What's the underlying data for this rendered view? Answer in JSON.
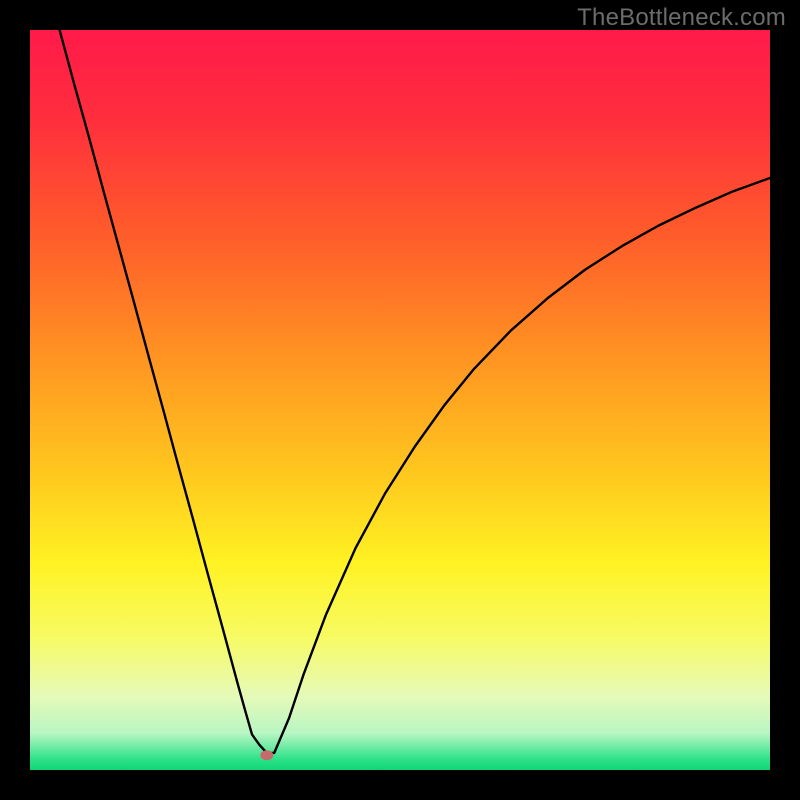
{
  "watermark": "TheBottleneck.com",
  "chart_data": {
    "type": "line",
    "title": "",
    "xlabel": "",
    "ylabel": "",
    "xlim": [
      0,
      100
    ],
    "ylim": [
      0,
      100
    ],
    "grid": false,
    "legend": false,
    "marker": {
      "x": 32,
      "y": 2
    },
    "series": [
      {
        "name": "curve",
        "x": [
          4,
          6,
          8,
          10,
          12,
          14,
          16,
          18,
          20,
          22,
          24,
          26,
          28,
          29,
          30,
          31,
          32,
          33,
          35,
          37,
          40,
          44,
          48,
          52,
          56,
          60,
          65,
          70,
          75,
          80,
          85,
          90,
          95,
          100
        ],
        "y": [
          100,
          92.6,
          85.4,
          78.0,
          70.7,
          63.4,
          56.0,
          48.7,
          41.3,
          34.0,
          26.6,
          19.3,
          11.9,
          8.3,
          4.8,
          3.4,
          2.3,
          2.3,
          7.0,
          13.0,
          21.0,
          30.0,
          37.4,
          43.7,
          49.3,
          54.2,
          59.4,
          63.8,
          67.6,
          70.8,
          73.6,
          76.0,
          78.2,
          80.0
        ]
      }
    ],
    "gradient_stops": [
      {
        "offset": 0.0,
        "color": "#ff1a4a"
      },
      {
        "offset": 0.12,
        "color": "#ff2e3d"
      },
      {
        "offset": 0.28,
        "color": "#ff5d2a"
      },
      {
        "offset": 0.44,
        "color": "#ff9322"
      },
      {
        "offset": 0.6,
        "color": "#ffc81e"
      },
      {
        "offset": 0.72,
        "color": "#fff223"
      },
      {
        "offset": 0.82,
        "color": "#f7fb63"
      },
      {
        "offset": 0.9,
        "color": "#e6fab8"
      },
      {
        "offset": 0.95,
        "color": "#b9f6c3"
      },
      {
        "offset": 0.985,
        "color": "#2fe28a"
      },
      {
        "offset": 1.0,
        "color": "#0fd676"
      }
    ]
  }
}
